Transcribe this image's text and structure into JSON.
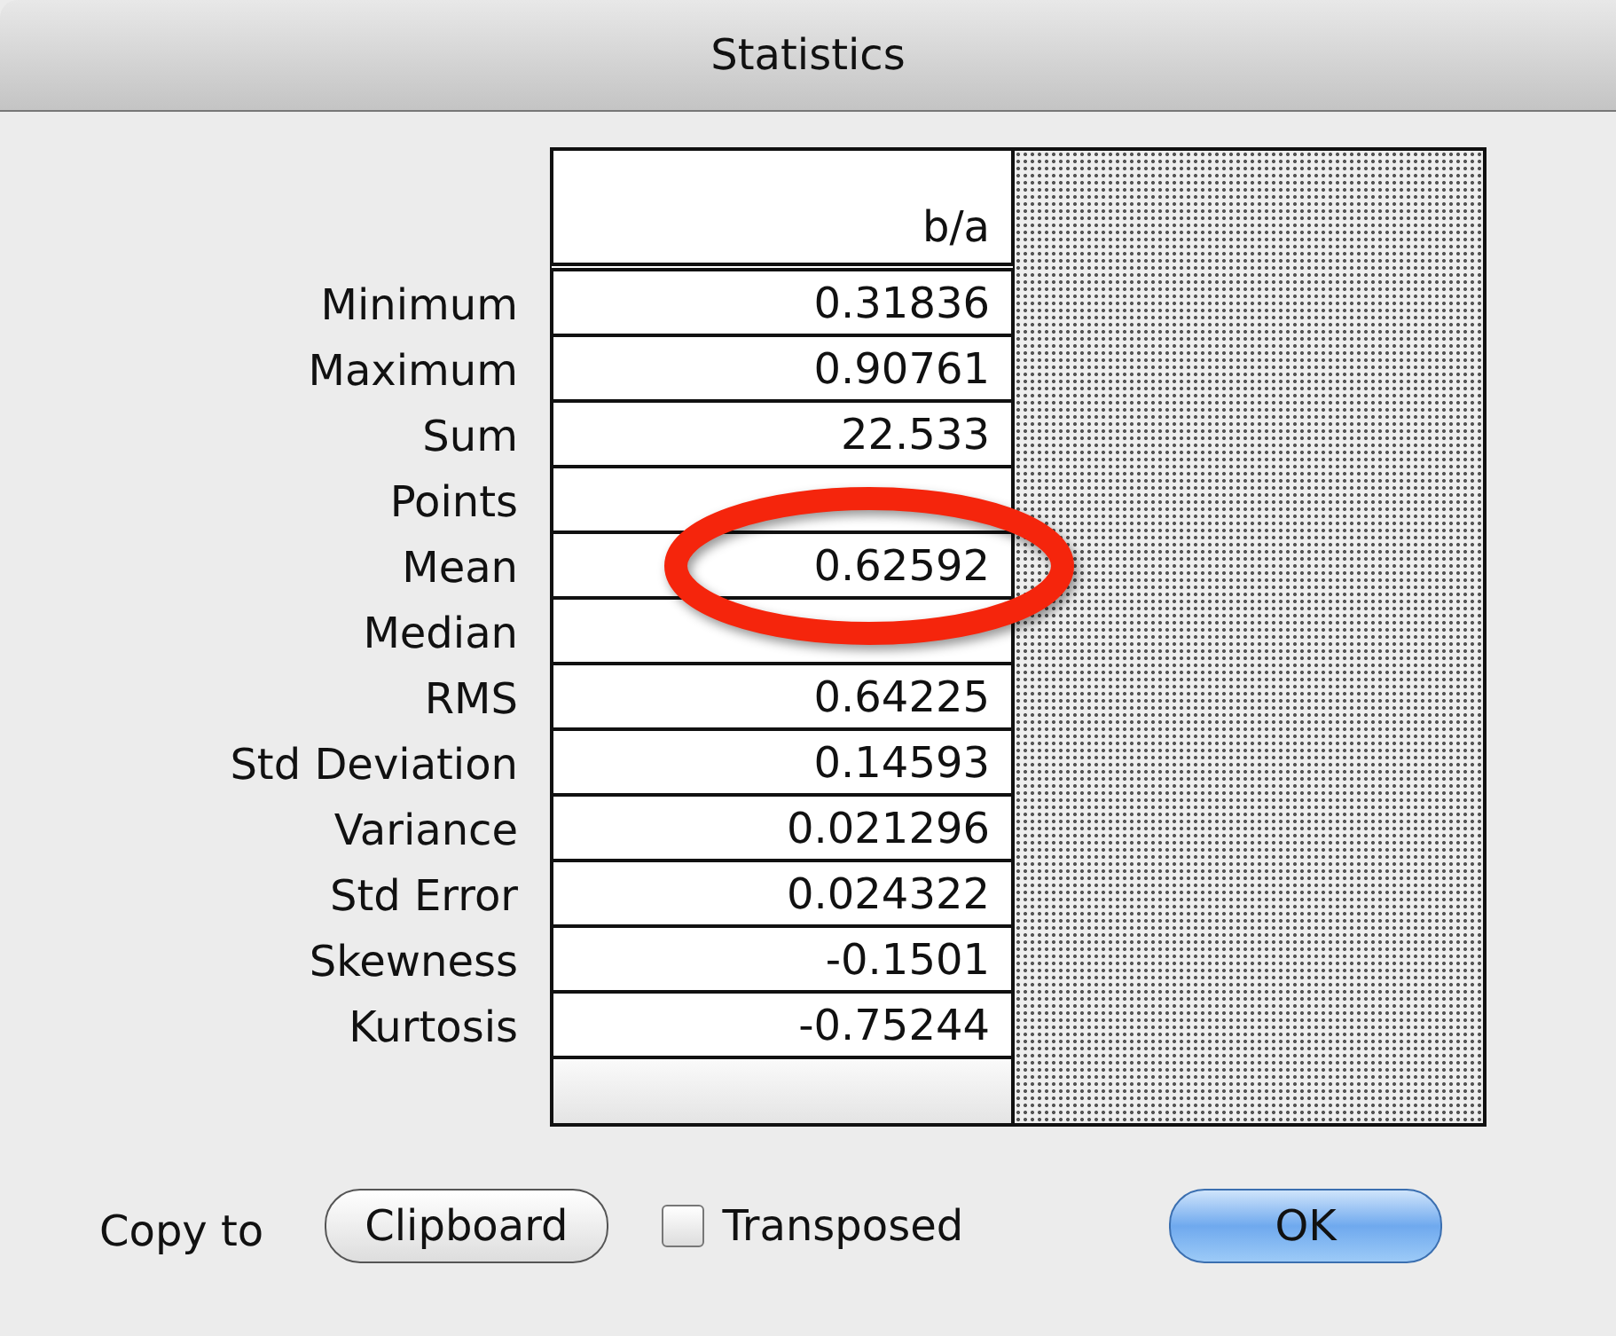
{
  "window": {
    "title": "Statistics"
  },
  "table": {
    "column": "b/a",
    "rows": [
      {
        "label": "Minimum",
        "value": "0.31836"
      },
      {
        "label": "Maximum",
        "value": "0.90761"
      },
      {
        "label": "Sum",
        "value": "22.533"
      },
      {
        "label": "Points"
      },
      {
        "label": "Mean",
        "value": "0.62592"
      },
      {
        "label": "Median"
      },
      {
        "label": "RMS",
        "value": "0.64225"
      },
      {
        "label": "Std Deviation",
        "value": "0.14593"
      },
      {
        "label": "Variance",
        "value": "0.021296"
      },
      {
        "label": "Std Error",
        "value": "0.024322"
      },
      {
        "label": "Skewness",
        "value": "-0.1501"
      },
      {
        "label": "Kurtosis",
        "value": "-0.75244"
      }
    ]
  },
  "footer": {
    "copy_label": "Copy to",
    "clipboard_button": "Clipboard",
    "transposed": {
      "label": "Transposed",
      "checked": false
    },
    "ok_button": "OK"
  }
}
